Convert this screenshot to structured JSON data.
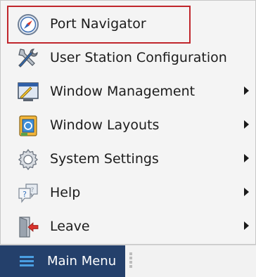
{
  "menu": {
    "items": [
      {
        "label": "Port Navigator",
        "icon": "compass-icon",
        "has_submenu": false,
        "highlighted": true
      },
      {
        "label": "User Station Configuration",
        "icon": "tools-icon",
        "has_submenu": false
      },
      {
        "label": "Window Management",
        "icon": "window-icon",
        "has_submenu": true
      },
      {
        "label": "Window Layouts",
        "icon": "layouts-icon",
        "has_submenu": true
      },
      {
        "label": "System Settings",
        "icon": "gear-icon",
        "has_submenu": true
      },
      {
        "label": "Help",
        "icon": "help-icon",
        "has_submenu": true
      },
      {
        "label": "Leave",
        "icon": "leave-icon",
        "has_submenu": true
      }
    ]
  },
  "taskbar": {
    "main_menu_label": "Main Menu",
    "main_menu_icon": "hamburger-icon"
  },
  "colors": {
    "highlight_border": "#c0262c",
    "taskbar_button": "#24406b",
    "hamburger": "#4a9fe3"
  }
}
